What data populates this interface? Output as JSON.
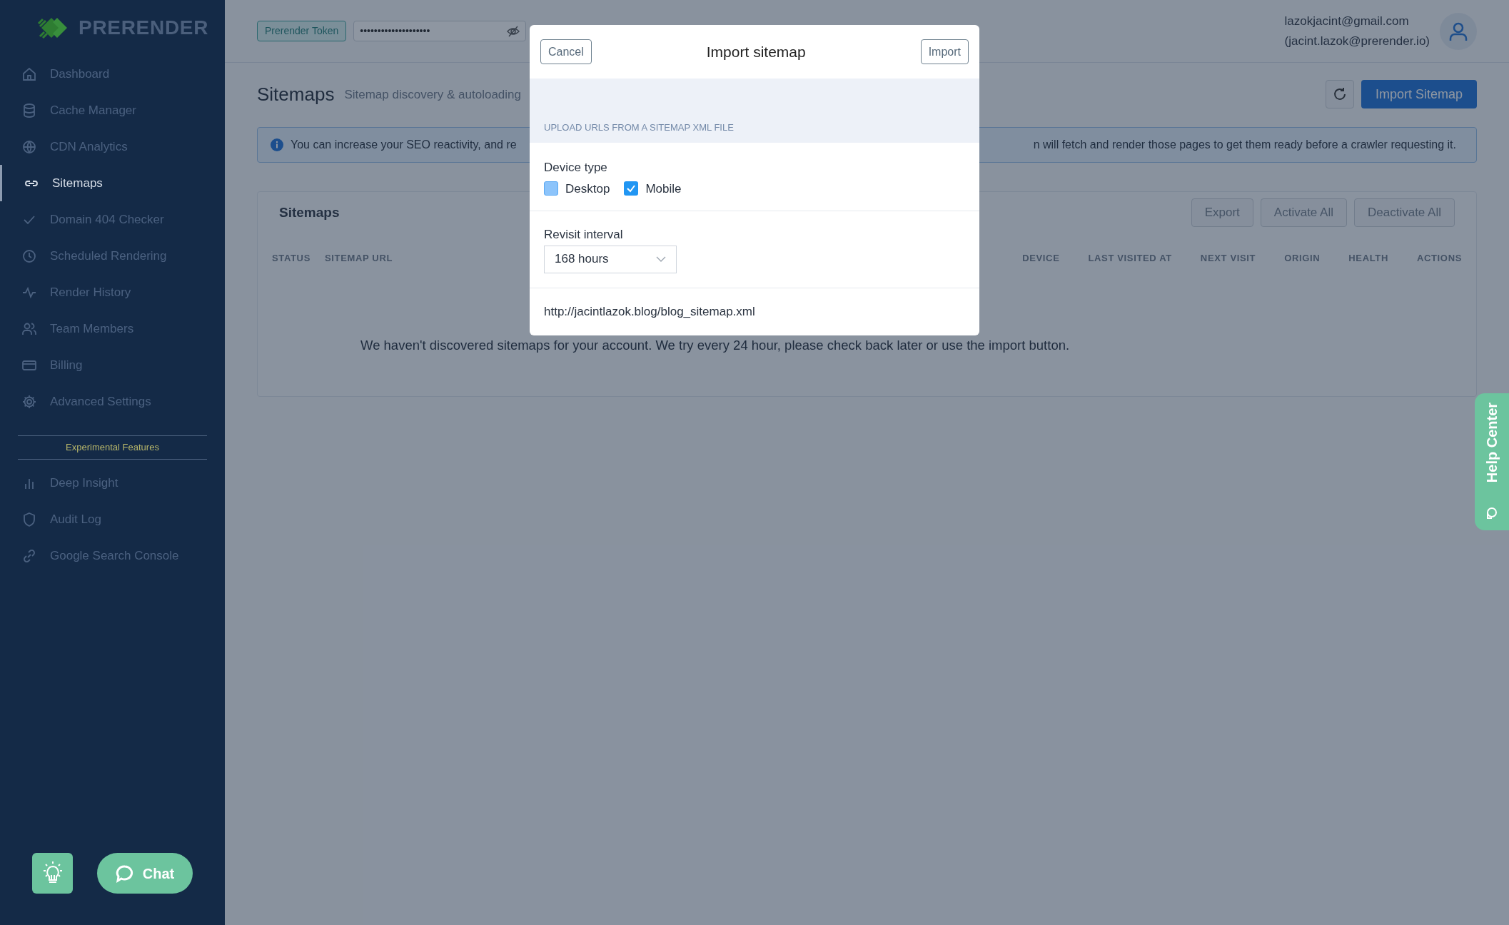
{
  "sidebar": {
    "logo": "PRERENDER",
    "items": [
      {
        "label": "Dashboard",
        "selected": false
      },
      {
        "label": "Cache Manager",
        "selected": false
      },
      {
        "label": "CDN Analytics",
        "selected": false
      },
      {
        "label": "Sitemaps",
        "selected": true
      },
      {
        "label": "Domain 404 Checker",
        "selected": false
      },
      {
        "label": "Scheduled Rendering",
        "selected": false
      },
      {
        "label": "Render History",
        "selected": false
      },
      {
        "label": "Team Members",
        "selected": false
      },
      {
        "label": "Billing",
        "selected": false
      },
      {
        "label": "Advanced Settings",
        "selected": false
      }
    ],
    "section_label": "Experimental Features",
    "experimental_items": [
      {
        "label": "Deep Insight",
        "selected": false
      },
      {
        "label": "Audit Log",
        "selected": false
      },
      {
        "label": "Google Search Console",
        "selected": false
      }
    ],
    "chat_button": "Chat"
  },
  "header": {
    "token_label": "Prerender Token",
    "token_value": "••••••••••••••••••••",
    "user_email": "lazokjacint@gmail.com",
    "user_alias": "(jacint.lazok@prerender.io)"
  },
  "page": {
    "title": "Sitemaps",
    "subtitle": "Sitemap discovery & autoloading",
    "import_button": "Import Sitemap",
    "info_left": "You can increase your SEO reactivity, and re",
    "info_right": "n will fetch and render those pages to get them ready before a crawler requesting it.",
    "card_title": "Sitemaps",
    "card_buttons": [
      "Export",
      "Activate All",
      "Deactivate All"
    ],
    "columns_left": [
      "STATUS",
      "SITEMAP URL"
    ],
    "columns_right": [
      "DEVICE",
      "LAST VISITED AT",
      "NEXT VISIT",
      "ORIGIN",
      "HEALTH",
      "ACTIONS"
    ],
    "empty_message": "We haven't discovered sitemaps for your account. We try every 24 hour, please check back later or use the import button."
  },
  "help_tab": "Help Center",
  "modal": {
    "title": "Import sitemap",
    "cancel": "Cancel",
    "confirm": "Import",
    "section_label": "UPLOAD URLS FROM A SITEMAP XML FILE",
    "device_label": "Device type",
    "devices": [
      {
        "label": "Desktop",
        "checked": false
      },
      {
        "label": "Mobile",
        "checked": true
      }
    ],
    "interval_label": "Revisit interval",
    "interval_value": "168 hours",
    "url": "http://jacintlazok.blog/blog_sitemap.xml"
  }
}
